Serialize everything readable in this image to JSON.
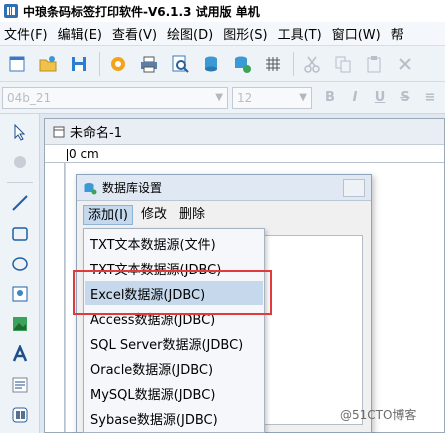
{
  "window": {
    "title": "中琅条码标签打印软件-V6.1.3 试用版 单机"
  },
  "menubar": {
    "items": [
      "文件(F)",
      "编辑(E)",
      "查看(V)",
      "绘图(D)",
      "图形(S)",
      "工具(T)",
      "窗口(W)",
      "帮"
    ]
  },
  "formatbar": {
    "font_name": "04b_21",
    "font_size": "12"
  },
  "document": {
    "tab_title": "未命名-1",
    "ruler_label": "0 cm"
  },
  "dialog": {
    "title": "数据库设置",
    "menu": {
      "add": "添加(I)",
      "modify": "修改",
      "delete": "删除"
    }
  },
  "dropdown": {
    "items": [
      "TXT文本数据源(文件)",
      "TXT文本数据源(JDBC)",
      "Excel数据源(JDBC)",
      "Access数据源(JDBC)",
      "SQL Server数据源(JDBC)",
      "Oracle数据源(JDBC)",
      "MySQL数据源(JDBC)",
      "Sybase数据源(JDBC)"
    ],
    "selected_index": 2
  },
  "watermark": "@51CTO博客",
  "colors": {
    "highlight": "#e03a3a",
    "selected_bg": "#c6d9ec"
  }
}
